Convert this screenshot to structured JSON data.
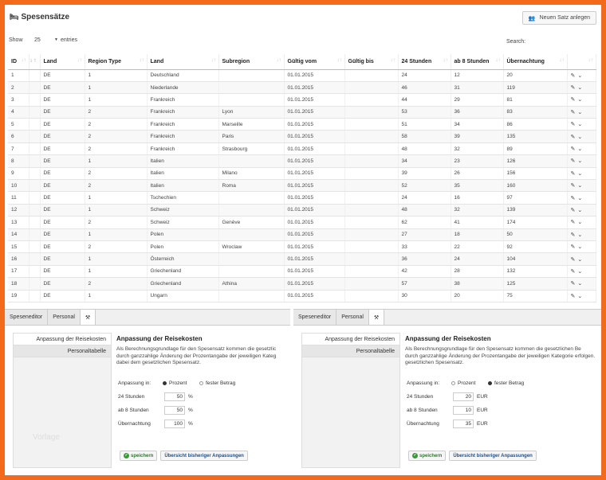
{
  "header": {
    "title": "Spesensätze",
    "new_button_label": "Neuen Satz anlegen"
  },
  "controls": {
    "show_label": "Show",
    "page_size": "25",
    "entries_label": "entries",
    "search_label": "Search:"
  },
  "table": {
    "columns": [
      "ID",
      "",
      "Land",
      "Region Type",
      "Land",
      "Subregion",
      "Gültig vom",
      "Gültig bis",
      "24 Stunden",
      "ab 8 Stunden",
      "Übernachtung",
      ""
    ],
    "rows": [
      [
        "1",
        "DE",
        "1",
        "Deutschland",
        "",
        "01.01.2015",
        "",
        "24",
        "12",
        "20"
      ],
      [
        "2",
        "DE",
        "1",
        "Niederlande",
        "",
        "01.01.2015",
        "",
        "46",
        "31",
        "119"
      ],
      [
        "3",
        "DE",
        "1",
        "Frankreich",
        "",
        "01.01.2015",
        "",
        "44",
        "29",
        "81"
      ],
      [
        "4",
        "DE",
        "2",
        "Frankreich",
        "Lyon",
        "01.01.2015",
        "",
        "53",
        "36",
        "83"
      ],
      [
        "5",
        "DE",
        "2",
        "Frankreich",
        "Marseille",
        "01.01.2015",
        "",
        "51",
        "34",
        "86"
      ],
      [
        "6",
        "DE",
        "2",
        "Frankreich",
        "Paris",
        "01.01.2015",
        "",
        "58",
        "39",
        "135"
      ],
      [
        "7",
        "DE",
        "2",
        "Frankreich",
        "Strasbourg",
        "01.01.2015",
        "",
        "48",
        "32",
        "89"
      ],
      [
        "8",
        "DE",
        "1",
        "Italien",
        "",
        "01.01.2015",
        "",
        "34",
        "23",
        "126"
      ],
      [
        "9",
        "DE",
        "2",
        "Italien",
        "Milano",
        "01.01.2015",
        "",
        "39",
        "26",
        "156"
      ],
      [
        "10",
        "DE",
        "2",
        "Italien",
        "Roma",
        "01.01.2015",
        "",
        "52",
        "35",
        "160"
      ],
      [
        "11",
        "DE",
        "1",
        "Tschechien",
        "",
        "01.01.2015",
        "",
        "24",
        "16",
        "97"
      ],
      [
        "12",
        "DE",
        "1",
        "Schweiz",
        "",
        "01.01.2015",
        "",
        "48",
        "32",
        "139"
      ],
      [
        "13",
        "DE",
        "2",
        "Schweiz",
        "Genève",
        "01.01.2015",
        "",
        "62",
        "41",
        "174"
      ],
      [
        "14",
        "DE",
        "1",
        "Polen",
        "",
        "01.01.2015",
        "",
        "27",
        "18",
        "50"
      ],
      [
        "15",
        "DE",
        "2",
        "Polen",
        "Wroclaw",
        "01.01.2015",
        "",
        "33",
        "22",
        "92"
      ],
      [
        "16",
        "DE",
        "1",
        "Österreich",
        "",
        "01.01.2015",
        "",
        "36",
        "24",
        "104"
      ],
      [
        "17",
        "DE",
        "1",
        "Griechenland",
        "",
        "01.01.2015",
        "",
        "42",
        "28",
        "132"
      ],
      [
        "18",
        "DE",
        "2",
        "Griechenland",
        "Athina",
        "01.01.2015",
        "",
        "57",
        "38",
        "125"
      ],
      [
        "19",
        "DE",
        "1",
        "Ungarn",
        "",
        "01.01.2015",
        "",
        "30",
        "20",
        "75"
      ]
    ]
  },
  "panels": [
    {
      "tabs": [
        "Speseneditor",
        "Personal"
      ],
      "sidebar": [
        "Anpassung der Reisekosten",
        "Personaltabelle"
      ],
      "watermark": "Vorlage",
      "heading": "Anpassung der Reisekosten",
      "desc_lines": [
        "Als Berechnungsgrundlage für den Spesensatz kommen die gesetzlic",
        "durch ganzzahlige Änderung der Prozentangabe der jeweiligen Kateg",
        "dabei dem gesetzlichen Spesensatz."
      ],
      "mode_label": "Anpassung in:",
      "mode_options": [
        "Prozent",
        "fester Betrag"
      ],
      "mode_selected": 0,
      "fields": [
        {
          "label": "24 Stunden",
          "value": "50",
          "unit": "%"
        },
        {
          "label": "ab 8 Stunden",
          "value": "50",
          "unit": "%"
        },
        {
          "label": "Übernachtung",
          "value": "100",
          "unit": "%"
        }
      ],
      "save_label": "speichern",
      "history_label": "Übersicht bisheriger Anpassungen"
    },
    {
      "tabs": [
        "Speseneditor",
        "Personal"
      ],
      "sidebar": [
        "Anpassung der Reisekosten",
        "Personaltabelle"
      ],
      "heading": "Anpassung der Reisekosten",
      "desc_lines": [
        "Als Berechnungsgrundlage für den Spesensatz kommen die gesetzlichen Be",
        "durch ganzzahlige Änderung der Prozentangabe der jeweiligen Kategorie erfolgen.",
        "gesetzlichen Spesensatz."
      ],
      "mode_label": "Anpassung in:",
      "mode_options": [
        "Prozent",
        "fester Betrag"
      ],
      "mode_selected": 1,
      "fields": [
        {
          "label": "24 Stunden",
          "value": "20",
          "unit": "EUR"
        },
        {
          "label": "ab 8 Stunden",
          "value": "10",
          "unit": "EUR"
        },
        {
          "label": "Übernachtung",
          "value": "35",
          "unit": "EUR"
        }
      ],
      "save_label": "speichern",
      "history_label": "Übersicht bisheriger Anpassungen"
    }
  ]
}
